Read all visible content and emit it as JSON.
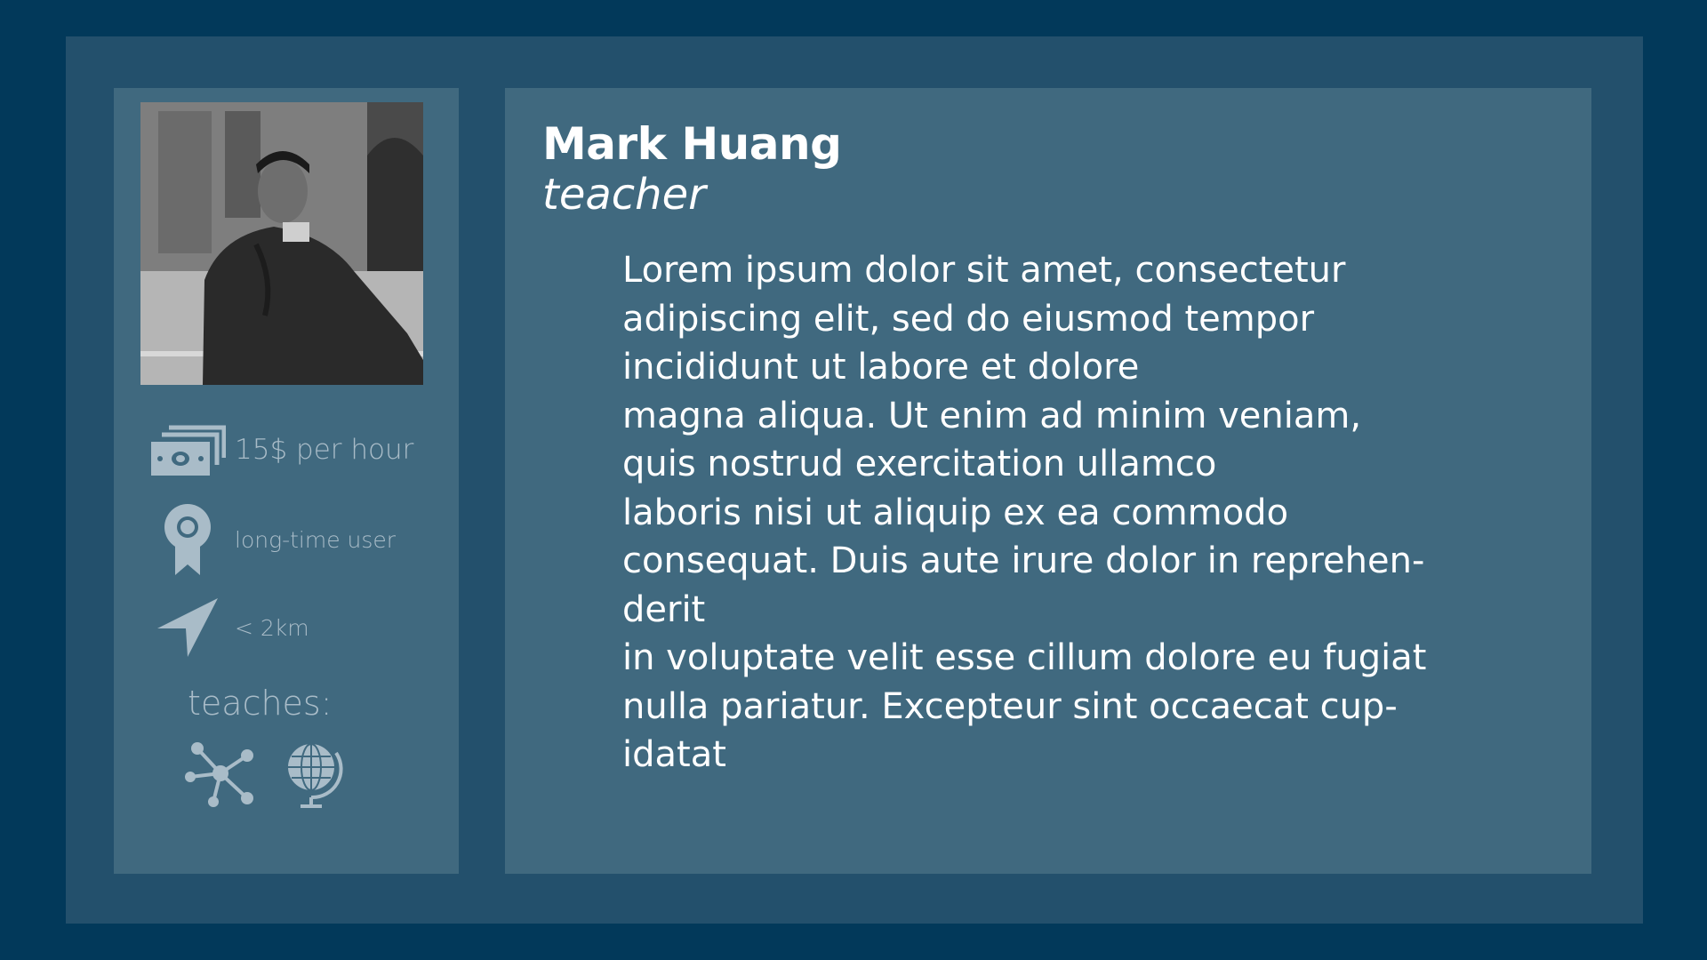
{
  "profile": {
    "name": "Mark Huang",
    "role": "teacher",
    "photo_icon": "profile-photo",
    "rate": {
      "label": "15$ per hour",
      "icon": "money-icon"
    },
    "badge": {
      "label": "long-time user",
      "icon": "award-icon"
    },
    "distance": {
      "label": "< 2km",
      "icon": "location-arrow-icon"
    },
    "teaches": {
      "label": "teaches:",
      "subjects": [
        {
          "icon": "molecule-icon"
        },
        {
          "icon": "globe-icon"
        }
      ]
    },
    "bio_lines": [
      "Lorem ipsum dolor sit amet, consectetur",
      "adipiscing elit, sed do  eiusmod tempor",
      "incididunt ut labore et dolore",
      "magna aliqua. Ut enim ad minim veniam,",
      "quis nostrud exercitation ullamco",
      "laboris nisi ut aliquip ex ea commodo",
      "consequat. Duis aute irure dolor in reprehen-",
      "derit",
      "in voluptate velit esse cillum dolore eu fugiat",
      "nulla pariatur. Excepteur sint occaecat cup-",
      "idatat"
    ]
  },
  "colors": {
    "background": "#02395a",
    "frame": "#23506c",
    "panel": "#40697f",
    "muted_text": "#a9bcc8",
    "text": "#ffffff"
  }
}
